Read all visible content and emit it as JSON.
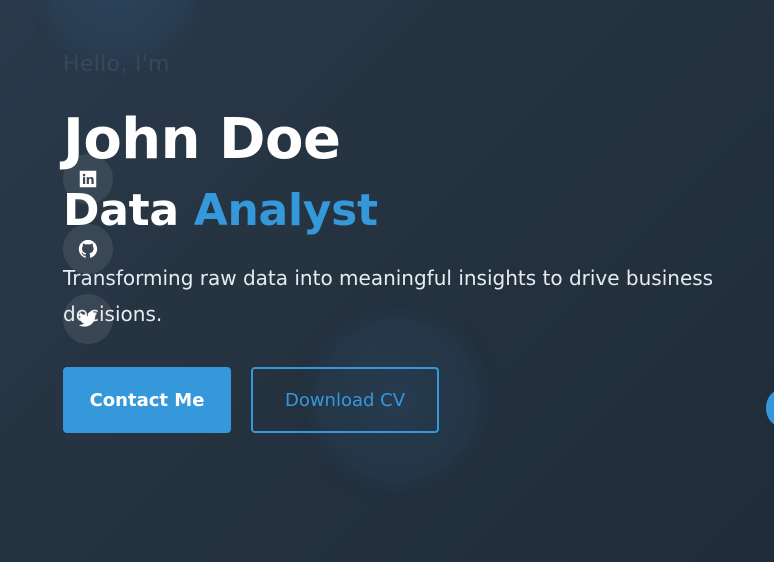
{
  "hero": {
    "greeting": "Hello, I'm",
    "name": "John Doe",
    "role_prefix": "Data",
    "role_accent": "Analyst",
    "tagline": "Transforming raw data into meaningful insights to drive business decisions."
  },
  "social": [
    {
      "icon": "linkedin-icon"
    },
    {
      "icon": "github-icon"
    },
    {
      "icon": "twitter-icon"
    }
  ],
  "buttons": {
    "primary_label": "Contact Me",
    "secondary_label": "Download CV"
  },
  "colors": {
    "accent": "#3498db",
    "background": "#25323f",
    "text": "#ffffff"
  }
}
